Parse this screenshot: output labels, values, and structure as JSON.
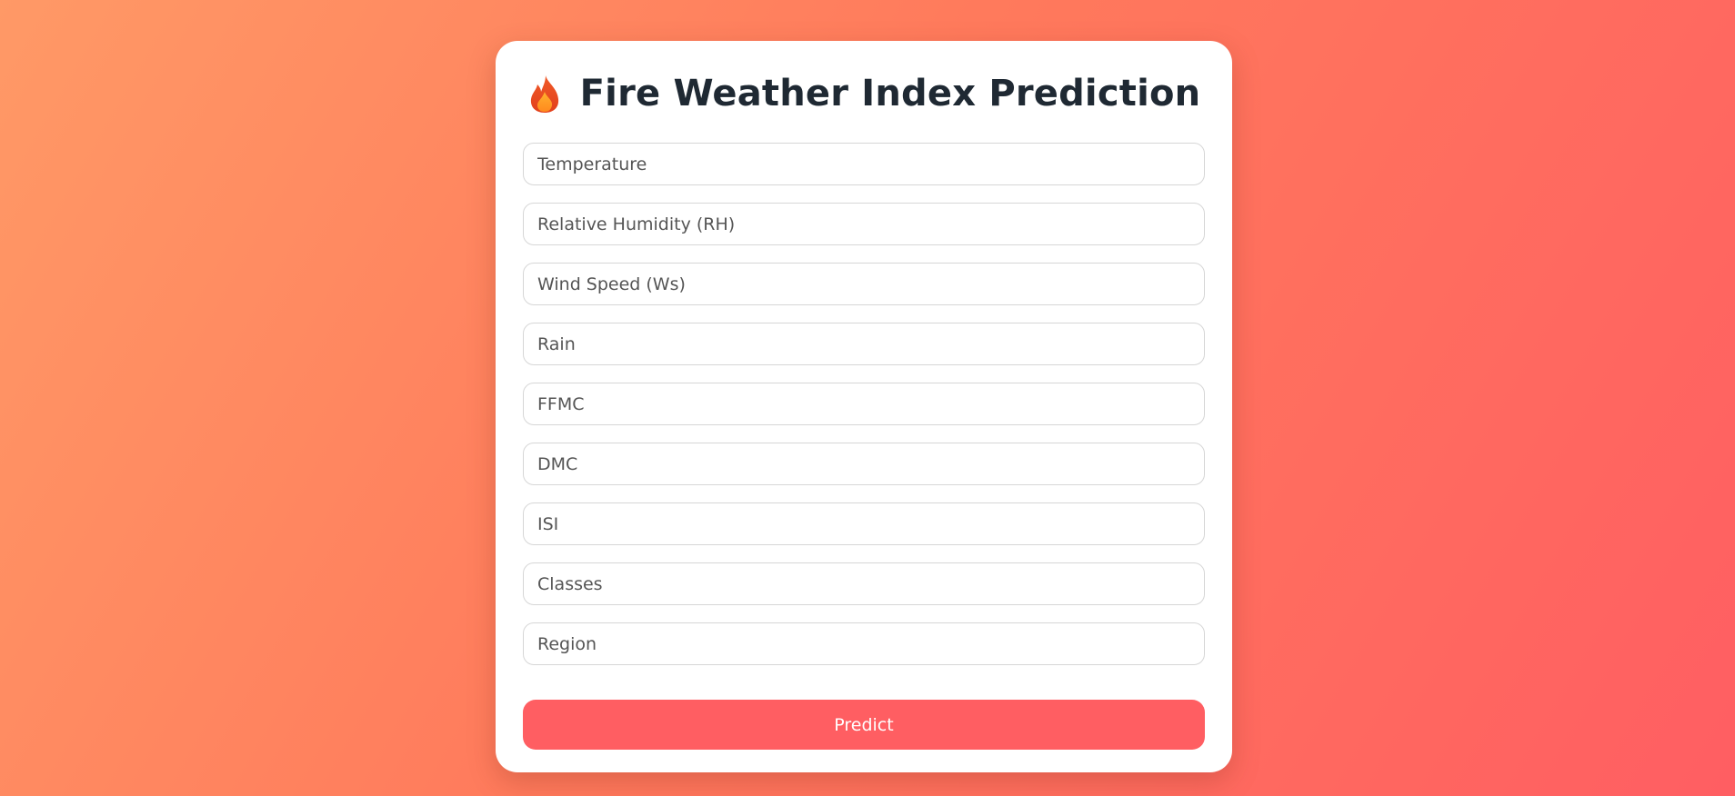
{
  "header": {
    "icon": "flame-icon",
    "title": "Fire Weather Index Prediction"
  },
  "form": {
    "fields": [
      {
        "placeholder": "Temperature",
        "value": ""
      },
      {
        "placeholder": "Relative Humidity (RH)",
        "value": ""
      },
      {
        "placeholder": "Wind Speed (Ws)",
        "value": ""
      },
      {
        "placeholder": "Rain",
        "value": ""
      },
      {
        "placeholder": "FFMC",
        "value": ""
      },
      {
        "placeholder": "DMC",
        "value": ""
      },
      {
        "placeholder": "ISI",
        "value": ""
      },
      {
        "placeholder": "Classes",
        "value": ""
      },
      {
        "placeholder": "Region",
        "value": ""
      }
    ],
    "submit_label": "Predict"
  },
  "colors": {
    "accent": "#ff5e62",
    "gradient_start": "#ff9966",
    "gradient_end": "#ff5e62",
    "card": "#ffffff",
    "title": "#1f2933"
  }
}
